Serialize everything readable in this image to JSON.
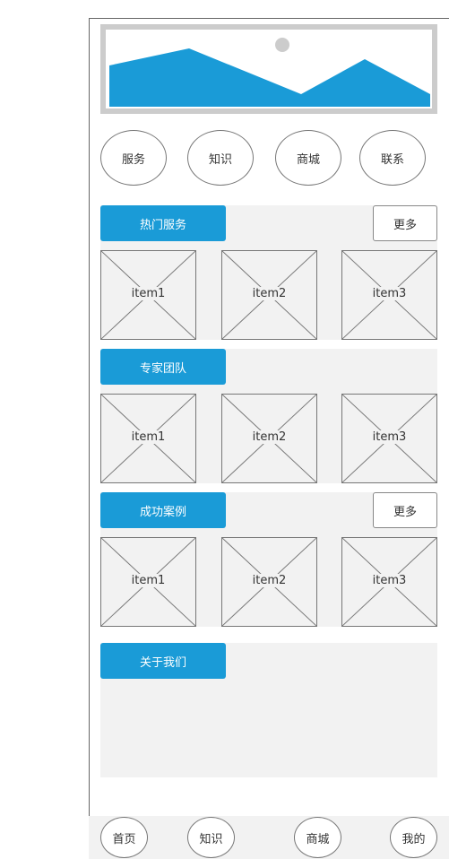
{
  "nav": {
    "items": [
      "服务",
      "知识",
      "商城",
      "联系"
    ]
  },
  "sections": {
    "hot_services": {
      "title": "热门服务",
      "more": "更多",
      "items": [
        "item1",
        "item2",
        "item3"
      ]
    },
    "expert_team": {
      "title": "专家团队",
      "items": [
        "item1",
        "item2",
        "item3"
      ]
    },
    "success_cases": {
      "title": "成功案例",
      "more": "更多",
      "items": [
        "item1",
        "item2",
        "item3"
      ]
    },
    "about_us": {
      "title": "关于我们"
    }
  },
  "tabbar": {
    "items": [
      "首页",
      "知识",
      "商城",
      "我的"
    ]
  },
  "colors": {
    "accent": "#1a9bd7",
    "placeholder_bg": "#f2f2f2",
    "banner_frame": "#cccccc"
  },
  "icons": {
    "banner": "landscape-image-placeholder",
    "item": "image-placeholder-x"
  }
}
